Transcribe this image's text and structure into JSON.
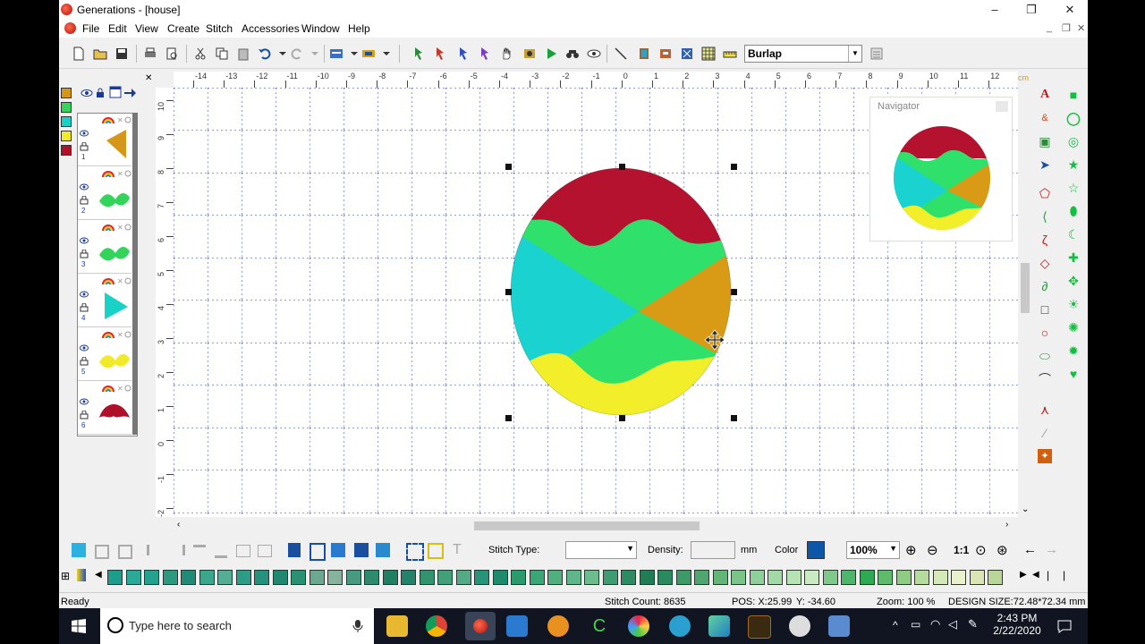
{
  "window": {
    "title": "Generations - [house]"
  },
  "menu": {
    "items": [
      "File",
      "Edit",
      "View",
      "Create",
      "Stitch",
      "Accessories",
      "Window",
      "Help"
    ]
  },
  "toolbar": {
    "fabric_value": "Burlap"
  },
  "ruler": {
    "unit": "cm",
    "top_labels": [
      "-14",
      "-13",
      "-12",
      "-11",
      "-10",
      "-9",
      "-8",
      "-7",
      "-6",
      "-5",
      "-4",
      "-3",
      "-2",
      "-1",
      "0",
      "1",
      "2",
      "3",
      "4",
      "5",
      "6",
      "7",
      "8",
      "9",
      "10",
      "11",
      "12"
    ],
    "left_labels": [
      "10",
      "9",
      "8",
      "7",
      "6",
      "5",
      "4",
      "3",
      "2",
      "1",
      "0",
      "-1",
      "-2"
    ]
  },
  "navigator": {
    "title": "Navigator"
  },
  "layers": [
    {
      "index": "1",
      "color": "#d6961a",
      "shape": "triangle"
    },
    {
      "index": "2",
      "color": "#32d45a",
      "shape": "wave"
    },
    {
      "index": "3",
      "color": "#32d45a",
      "shape": "wave"
    },
    {
      "index": "4",
      "color": "#18d2c8",
      "shape": "triangle-right"
    },
    {
      "index": "5",
      "color": "#f0ea28",
      "shape": "wave"
    },
    {
      "index": "6",
      "color": "#b0102a",
      "shape": "cap"
    }
  ],
  "design_colors": {
    "red": "#b5122f",
    "green": "#2fe06a",
    "cyan": "#1ad3d0",
    "orange": "#d99a16",
    "yellow": "#f2ee2a"
  },
  "bottom_toolbar": {
    "stitch_type_label": "Stitch Type:",
    "stitch_type_value": "",
    "density_label": "Density:",
    "density_value": "",
    "density_unit": "mm",
    "color_label": "Color",
    "color_value": "#0e56a8",
    "zoom_value": "100%",
    "ratio_label": "1:1"
  },
  "palette": [
    "#1d9e8c",
    "#2aa898",
    "#23a38f",
    "#2c9a7e",
    "#208c78",
    "#3aa68c",
    "#55ad96",
    "#2d9d88",
    "#24927c",
    "#1e8870",
    "#2a9273",
    "#6aa88f",
    "#85b39e",
    "#47997f",
    "#2e8a6c",
    "#1f7f63",
    "#23836a",
    "#31946f",
    "#42a07a",
    "#52ab86",
    "#27947a",
    "#1e8b6d",
    "#2b9a6d",
    "#3aa777",
    "#4fb07e",
    "#5fb789",
    "#6cbd8d",
    "#3c9d73",
    "#2b8c62",
    "#1f7c55",
    "#2a8a5d",
    "#3b9a66",
    "#4fa66e",
    "#64b57a",
    "#7ac38a",
    "#8fd09a",
    "#a3d9a7",
    "#b7e2b4",
    "#c9eac2",
    "#7fc88c",
    "#4cb76a",
    "#2faa54",
    "#5dbb6b",
    "#8ecc84",
    "#b3dc9d",
    "#d4e8b8",
    "#e8f0cd",
    "#d9e6b3",
    "#b9d699"
  ],
  "status": {
    "ready": "Ready",
    "stitch_count": "Stitch Count: 8635",
    "pos_x": "POS: X:25.99",
    "pos_y": "Y: -34.60",
    "zoom": "Zoom: 100 %",
    "design_size": "DESIGN SIZE:72.48*72.34 mm"
  },
  "taskbar": {
    "search_placeholder": "Type here to search",
    "time": "2:43 PM",
    "date": "2/22/2020"
  }
}
